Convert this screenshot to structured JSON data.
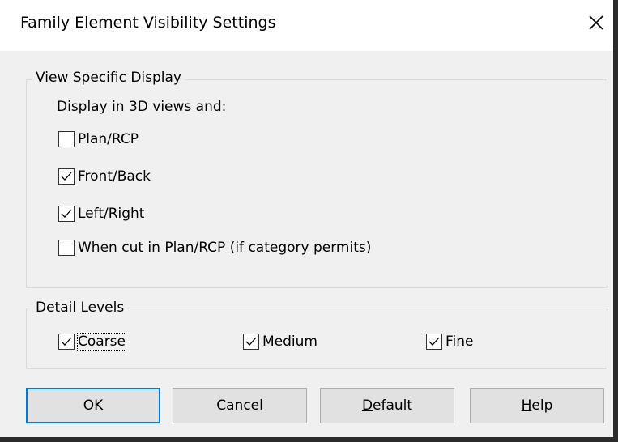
{
  "dialog": {
    "title": "Family Element Visibility Settings",
    "close_icon": "close-icon"
  },
  "view_specific": {
    "legend": "View Specific Display",
    "subtitle": "Display in 3D views and:",
    "options": [
      {
        "label": "Plan/RCP",
        "checked": false
      },
      {
        "label": "Front/Back",
        "checked": true
      },
      {
        "label": "Left/Right",
        "checked": true
      },
      {
        "label": "When cut in Plan/RCP (if category permits)",
        "checked": false
      }
    ]
  },
  "detail_levels": {
    "legend": "Detail Levels",
    "options": [
      {
        "label": "Coarse",
        "checked": true
      },
      {
        "label": "Medium",
        "checked": true
      },
      {
        "label": "Fine",
        "checked": true
      }
    ]
  },
  "buttons": {
    "ok": "OK",
    "cancel": "Cancel",
    "default_first": "D",
    "default_rest": "efault",
    "help_first": "H",
    "help_rest": "elp"
  },
  "colors": {
    "accent": "#0078d7",
    "background": "#f0f0f0"
  }
}
